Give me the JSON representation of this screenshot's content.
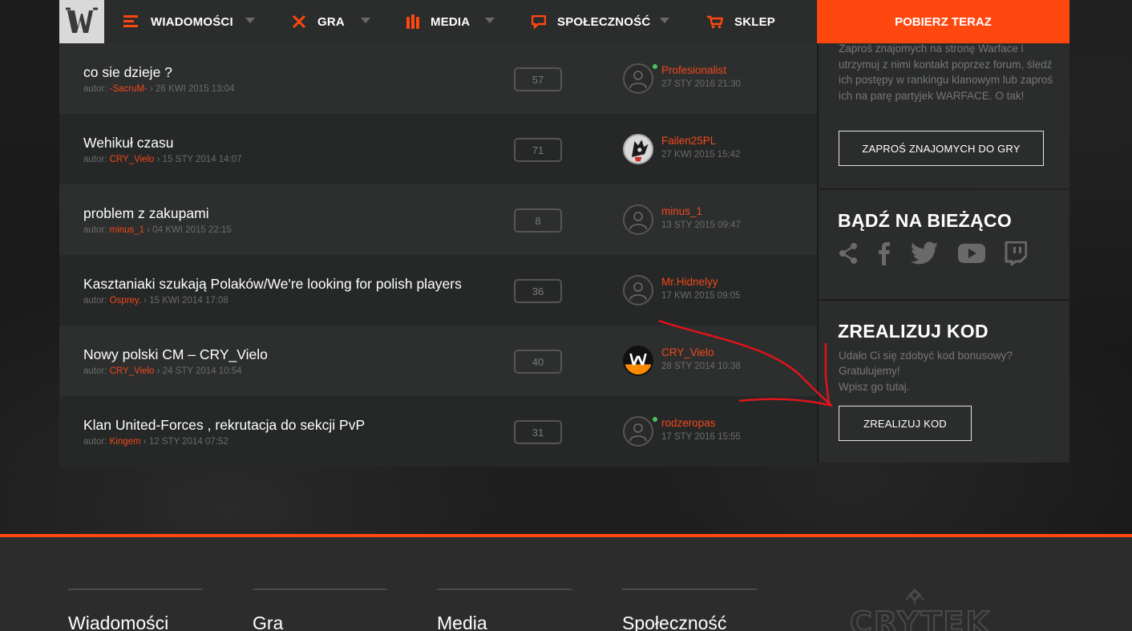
{
  "nav": {
    "items": [
      {
        "label": "WIADOMOŚCI",
        "icon": "news-lines-icon"
      },
      {
        "label": "GRA",
        "icon": "crossed-swords-icon"
      },
      {
        "label": "MEDIA",
        "icon": "ammo-icon"
      },
      {
        "label": "SPOŁECZNOŚĆ",
        "icon": "speech-bubble-icon"
      },
      {
        "label": "SKLEP",
        "icon": "cart-icon"
      }
    ],
    "cta_label": "POBIERZ TERAZ",
    "accent": "#ff4810"
  },
  "topics": [
    {
      "title": "co sie dzieje ?",
      "meta_prefix": "autor: ",
      "author": "-SacruM-",
      "meta_suffix": " › 26 KWI 2015 13:04",
      "replies": "57",
      "last_user": "Profesionalist",
      "last_date": "27 STY 2016 21:30",
      "online": true,
      "avatar": "default"
    },
    {
      "title": "Wehikuł czasu",
      "meta_prefix": "autor: ",
      "author": "CRY_Vielo",
      "meta_suffix": " › 15 STY 2014 14:07",
      "replies": "71",
      "last_user": "Failen25PL",
      "last_date": "27 KWI 2015 15:42",
      "online": false,
      "avatar": "shadow"
    },
    {
      "title": "problem z zakupami",
      "meta_prefix": "autor: ",
      "author": "minus_1",
      "meta_suffix": " › 04 KWI 2015 22:15",
      "replies": "8",
      "last_user": "minus_1",
      "last_date": "13 STY 2015 09:47",
      "online": false,
      "avatar": "default"
    },
    {
      "title": "Kasztaniaki szukają Polaków/We're looking for polish players",
      "meta_prefix": "autor: ",
      "author": "Osprey.",
      "meta_suffix": " › 15 KWI 2014 17:08",
      "replies": "36",
      "last_user": "Mr.Hidnelyy",
      "last_date": "17 KWI 2015 09:05",
      "online": false,
      "avatar": "default"
    },
    {
      "title": "Nowy polski CM – CRY_Vielo",
      "meta_prefix": "autor: ",
      "author": "CRY_Vielo",
      "meta_suffix": " › 24 STY 2014 10:54",
      "replies": "40",
      "last_user": "CRY_Vielo",
      "last_date": "28 STY 2014 10:38",
      "online": false,
      "avatar": "warface"
    },
    {
      "title": "Klan United-Forces , rekrutacja do sekcji PvP",
      "meta_prefix": "autor: ",
      "author": "Kingem",
      "meta_suffix": " › 12 STY 2014 07:52",
      "replies": "31",
      "last_user": "rodzeropas",
      "last_date": "17 STY 2016 15:55",
      "online": true,
      "avatar": "default"
    }
  ],
  "sidebar": {
    "invite": {
      "text": "Zaproś znajomych na stronę Warface i utrzymuj z nimi kontakt poprzez forum, śledź ich postępy w rankingu klanowym lub zaproś ich na parę partyjek WARFACE. O tak!",
      "button": "ZAPROŚ ZNAJOMYCH DO GRY"
    },
    "social": {
      "title": "BĄDŹ NA BIEŻĄCO",
      "icons": [
        "share-icon",
        "facebook-icon",
        "twitter-icon",
        "youtube-icon",
        "twitch-icon"
      ]
    },
    "redeem": {
      "title": "ZREALIZUJ KOD",
      "text1": "Udało Ci się zdobyć kod bonusowy?",
      "text2": "Gratulujemy!",
      "text3": "Wpisz go tutaj.",
      "button": "ZREALIZUJ KOD"
    }
  },
  "footer": {
    "columns": [
      "Wiadomości",
      "Gra",
      "Media",
      "Społeczność"
    ],
    "brand": "CRYTEK"
  }
}
